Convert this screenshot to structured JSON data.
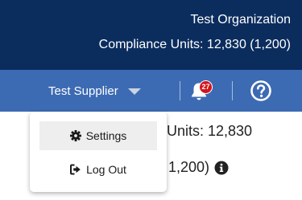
{
  "header": {
    "organization_name": "Test Organization",
    "compliance_units": "Compliance Units: 12,830 (1,200)"
  },
  "navbar": {
    "supplier_name": "Test Supplier",
    "notification_count": "27"
  },
  "dropdown": {
    "items": [
      {
        "label": "Settings",
        "icon": "gear-icon"
      },
      {
        "label": "Log Out",
        "icon": "sign-out-icon"
      }
    ]
  },
  "background": {
    "units_text": "Units: 12,830",
    "units_sub_text": "1,200)",
    "fragment_text": "("
  },
  "colors": {
    "header_bg": "#0b2d5e",
    "navbar_bg": "#3d6bb3",
    "badge_bg": "#d3151d"
  }
}
